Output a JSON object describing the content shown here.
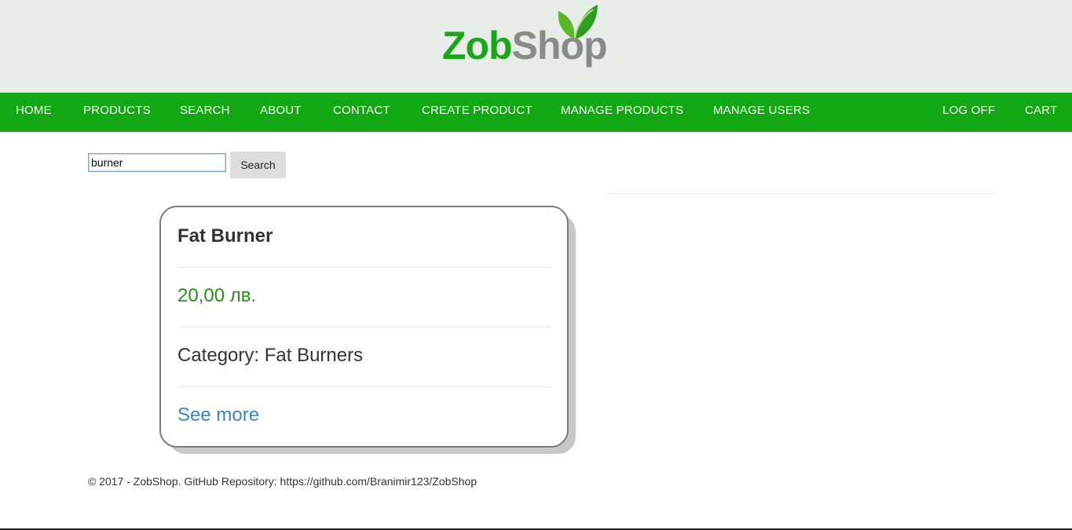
{
  "brand": {
    "name_part1": "Zob",
    "name_part2": "Shop",
    "colors": {
      "primary_green": "#13a813",
      "logo_gray": "#8a8a8a",
      "header_bg": "#e7ede7"
    }
  },
  "nav": {
    "home": "HOME",
    "products": "PRODUCTS",
    "search": "SEARCH",
    "about": "ABOUT",
    "contact": "CONTACT",
    "create_product": "CREATE PRODUCT",
    "manage_products": "MANAGE PRODUCTS",
    "manage_users": "MANAGE USERS",
    "log_off": "LOG OFF",
    "cart": "CART"
  },
  "search": {
    "value": "burner",
    "button_label": "Search"
  },
  "results": [
    {
      "title": "Fat Burner",
      "price": "20,00 лв.",
      "category": "Category: Fat Burners",
      "link_label": "See more"
    }
  ],
  "footer": {
    "text": "© 2017 - ZobShop. GitHub Repository: https://github.com/Branimir123/ZobShop"
  },
  "icons": {
    "logo_leaf": "leaf-icon"
  }
}
